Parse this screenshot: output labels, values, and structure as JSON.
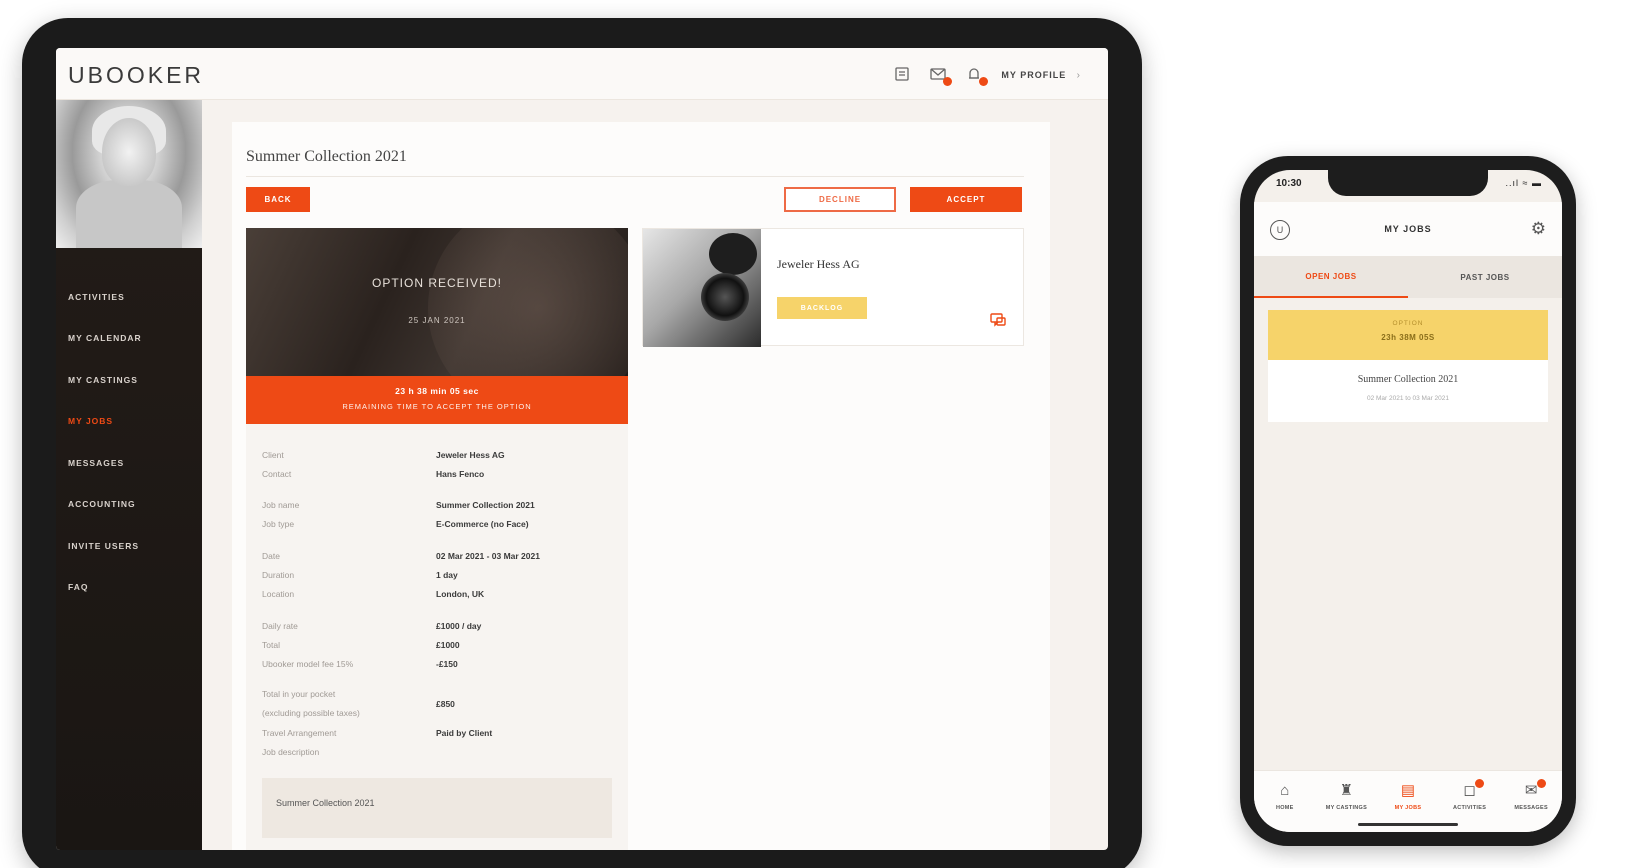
{
  "tablet": {
    "logo": "UBOOKER",
    "header": {
      "profile_label": "MY PROFILE",
      "profile_chevron": "›"
    },
    "nav": [
      {
        "label": "ACTIVITIES"
      },
      {
        "label": "MY CALENDAR"
      },
      {
        "label": "MY CASTINGS"
      },
      {
        "label": "MY JOBS",
        "active": true
      },
      {
        "label": "MESSAGES"
      },
      {
        "label": "ACCOUNTING"
      },
      {
        "label": "INVITE USERS"
      },
      {
        "label": "FAQ"
      }
    ],
    "job": {
      "title": "Summer Collection 2021",
      "back_label": "BACK",
      "decline_label": "DECLINE",
      "accept_label": "ACCEPT",
      "hero_title": "OPTION RECEIVED!",
      "hero_date": "25 JAN 2021",
      "countdown_time": "23 h 38 min 05 sec",
      "countdown_note": "REMAINING TIME TO ACCEPT THE OPTION"
    },
    "details": [
      {
        "label": "Client",
        "value": "Jeweler Hess AG"
      },
      {
        "label": "Contact",
        "value": "Hans Fenco"
      },
      {
        "label": "Job name",
        "value": "Summer Collection 2021"
      },
      {
        "label": "Job type",
        "value": "E-Commerce (no Face)"
      },
      {
        "label": "Date",
        "value": "02 Mar 2021 - 03 Mar 2021"
      },
      {
        "label": "Duration",
        "value": "1 day"
      },
      {
        "label": "Location",
        "value": "London, UK"
      },
      {
        "label": "Daily rate",
        "value": "£1000 / day"
      },
      {
        "label": "Total",
        "value": "£1000"
      },
      {
        "label": "Ubooker model fee 15%",
        "value": "-£150"
      },
      {
        "label": "Total in your pocket",
        "value": "£850"
      },
      {
        "label": "(excluding possible taxes)",
        "value": ""
      },
      {
        "label": "Travel Arrangement",
        "value": "Paid by Client"
      },
      {
        "label": "Job description",
        "value": ""
      }
    ],
    "description_title": "Summer Collection 2021",
    "client_card": {
      "name": "Jeweler Hess AG",
      "badge": "BACKLOG"
    }
  },
  "phone": {
    "status_time": "10:30",
    "status_icons": "..ıl ≈ ▬",
    "title": "MY JOBS",
    "tabs": [
      {
        "label": "OPEN JOBS",
        "active": true
      },
      {
        "label": "PAST JOBS"
      }
    ],
    "card": {
      "status_label": "OPTION",
      "status_value": "23h 38M 05S",
      "title": "Summer Collection 2021",
      "dates": "02 Mar 2021 to 03 Mar 2021"
    },
    "tabbar": [
      {
        "label": "HOME",
        "icon": "home-icon"
      },
      {
        "label": "MY CASTINGS",
        "icon": "castings-icon"
      },
      {
        "label": "MY JOBS",
        "icon": "jobs-icon",
        "active": true
      },
      {
        "label": "ACTIVITIES",
        "icon": "activities-icon",
        "badge": true
      },
      {
        "label": "MESSAGES",
        "icon": "messages-icon",
        "badge": true
      }
    ]
  },
  "colors": {
    "accent": "#ee4a15",
    "yellow": "#f6d36a",
    "sidebar": "#1f1915"
  }
}
